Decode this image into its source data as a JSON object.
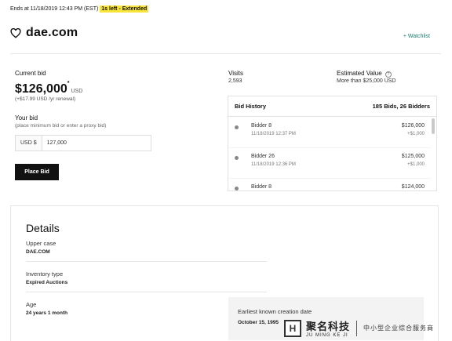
{
  "auction": {
    "ends_text": "Ends at 11/18/2019 12:43 PM (EST)",
    "time_left_badge": "1s left - Extended"
  },
  "domain": {
    "name": "dae.com",
    "watchlist_label": "+ Watchlist"
  },
  "bid": {
    "current_label": "Current bid",
    "current_amount": "$126,000",
    "asterisk": "*",
    "currency": "USD",
    "renewal": "(+$17.99 USD /yr renewal)",
    "your_bid_label": "Your bid",
    "your_bid_hint": "(place minimum bid or enter a proxy bid)",
    "input_prefix": "USD $",
    "input_value": "127,000",
    "place_bid_label": "Place Bid"
  },
  "stats": {
    "visits_label": "Visits",
    "visits_value": "2,593",
    "estimated_label": "Estimated Value",
    "estimated_help_icon": "?",
    "estimated_value": "More than $25,000 USD"
  },
  "history": {
    "title": "Bid History",
    "summary": "185 Bids, 26 Bidders",
    "rows": [
      {
        "bidder": "Bidder 8",
        "time": "11/18/2019 12:37 PM",
        "amount": "$126,000",
        "increment": "+$1,000"
      },
      {
        "bidder": "Bidder 26",
        "time": "11/18/2019 12:36 PM",
        "amount": "$125,000",
        "increment": "+$1,000"
      },
      {
        "bidder": "Bidder 8",
        "time": "",
        "amount": "$124,000",
        "increment": ""
      }
    ]
  },
  "details": {
    "title": "Details",
    "upper_case_label": "Upper case",
    "upper_case_value": "DAE.COM",
    "inventory_label": "Inventory type",
    "inventory_value": "Expired Auctions",
    "age_label": "Age",
    "age_value": "24 years 1 month",
    "creation_label": "Earliest known creation date",
    "creation_value": "October 15, 1995"
  },
  "watermark": {
    "mark": "H",
    "name_cn": "聚名科技",
    "name_en": "JU MING KE JI",
    "slogan": "中小型企业综合服务商"
  },
  "colors": {
    "highlight": "#f8e43b",
    "accent_green": "#1b7f6e",
    "button": "#111111"
  }
}
